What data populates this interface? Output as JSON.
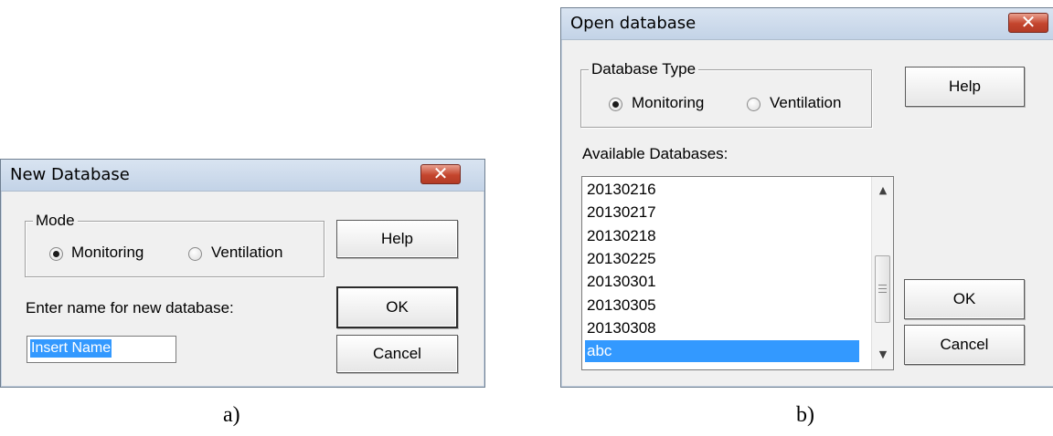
{
  "dialog_a": {
    "title": "New Database",
    "close_glyph": "✕",
    "mode_group": {
      "legend": "Mode",
      "options": [
        {
          "label": "Monitoring",
          "selected": true
        },
        {
          "label": "Ventilation",
          "selected": false
        }
      ]
    },
    "name_label": "Enter name for new database:",
    "name_input_value": "Insert Name",
    "help_button": "Help",
    "ok_button": "OK",
    "cancel_button": "Cancel"
  },
  "dialog_b": {
    "title": "Open database",
    "close_glyph": "✕",
    "type_group": {
      "legend": "Database Type",
      "options": [
        {
          "label": "Monitoring",
          "selected": true
        },
        {
          "label": "Ventilation",
          "selected": false
        }
      ]
    },
    "available_label": "Available Databases:",
    "databases": [
      "20130216",
      "20130217",
      "20130218",
      "20130225",
      "20130301",
      "20130305",
      "20130308",
      "abc"
    ],
    "selected_database": "abc",
    "help_button": "Help",
    "ok_button": "OK",
    "cancel_button": "Cancel",
    "scroll_up_icon": "▲",
    "scroll_down_icon": "▼"
  },
  "captions": {
    "a": "a)",
    "b": "b)"
  },
  "colors": {
    "selection": "#3399ff",
    "close_button": "#c4452d",
    "dialog_background": "#f0f0f0"
  }
}
